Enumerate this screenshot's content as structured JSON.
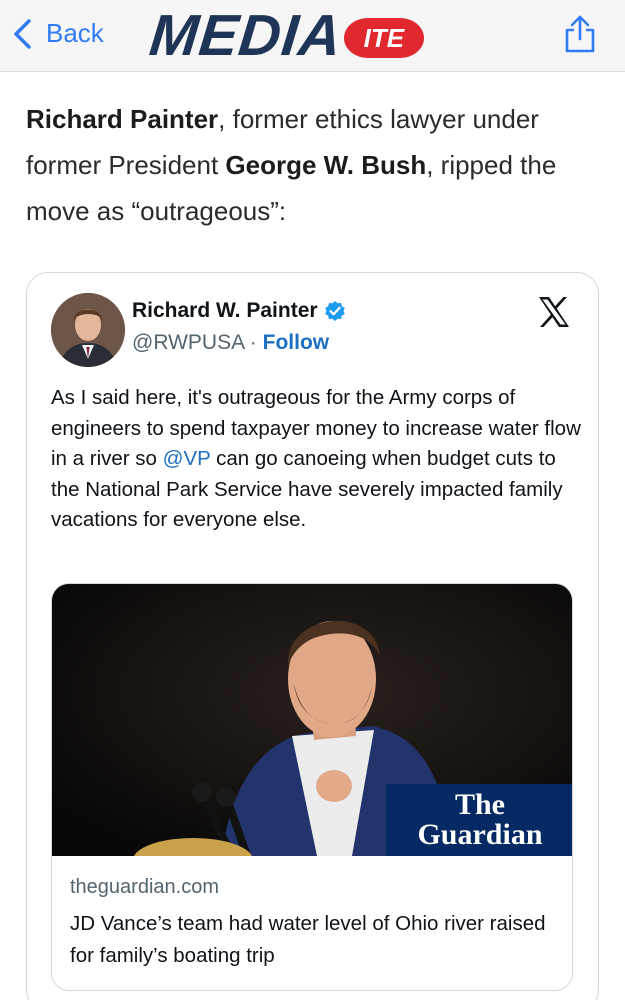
{
  "nav": {
    "back_label": "Back",
    "logo_main": "MEDIA",
    "logo_badge": "ITE",
    "accent_color": "#2f7cf6"
  },
  "article": {
    "name1": "Richard Painter",
    "text1": ", former ethics lawyer under former President ",
    "name2": "George W. Bush",
    "text2": ", ripped the move as “outrageous”:"
  },
  "tweet": {
    "author_name": "Richard W. Painter",
    "handle": "@RWPUSA",
    "separator": "·",
    "follow_label": "Follow",
    "text_before": "As I said here, it's outrageous for the Army corps of engineers to spend taxpayer money to increase water flow in a river so ",
    "mention": "@VP",
    "text_after": " can go canoeing when budget cuts to the National Park Service have severely impacted family vacations for everyone else.",
    "icons": [
      "verified-badge-icon",
      "x-logo-icon"
    ]
  },
  "link_card": {
    "badge_line1": "The",
    "badge_line2": "Guardian",
    "domain": "theguardian.com",
    "title": "JD Vance’s team had water level of Ohio river raised for family’s boating trip"
  }
}
